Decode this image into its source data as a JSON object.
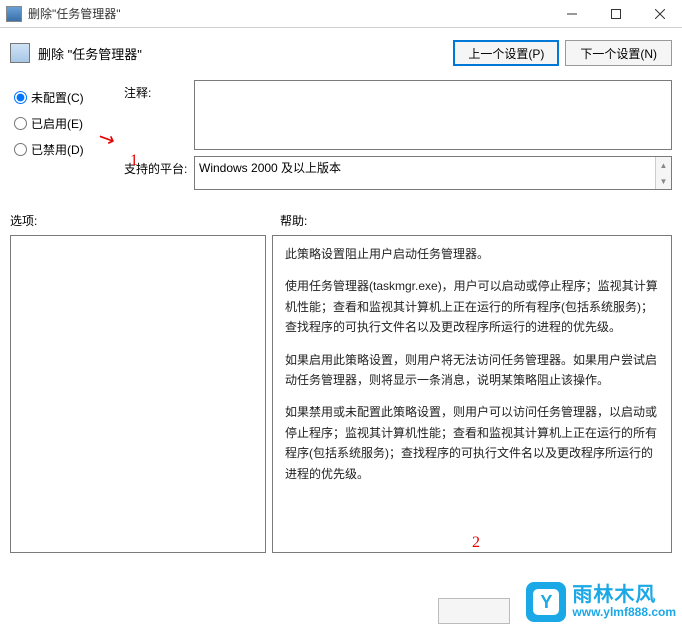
{
  "window": {
    "title": "删除\"任务管理器\""
  },
  "header": {
    "title": "删除 \"任务管理器\"",
    "prev_btn": "上一个设置(P)",
    "next_btn": "下一个设置(N)"
  },
  "radios": {
    "not_configured": "未配置(C)",
    "enabled": "已启用(E)",
    "disabled": "已禁用(D)",
    "selected": "not_configured"
  },
  "fields": {
    "comment_label": "注释:",
    "comment_value": "",
    "platform_label": "支持的平台:",
    "platform_value": "Windows 2000 及以上版本"
  },
  "labels": {
    "options": "选项:",
    "help": "帮助:"
  },
  "help": {
    "p1": "此策略设置阻止用户启动任务管理器。",
    "p2": "使用任务管理器(taskmgr.exe)，用户可以启动或停止程序；监视其计算机性能；查看和监视其计算机上正在运行的所有程序(包括系统服务)；查找程序的可执行文件名以及更改程序所运行的进程的优先级。",
    "p3": "如果启用此策略设置，则用户将无法访问任务管理器。如果用户尝试启动任务管理器，则将显示一条消息，说明某策略阻止该操作。",
    "p4": "如果禁用或未配置此策略设置，则用户可以访问任务管理器，以启动或停止程序；监视其计算机性能；查看和监视其计算机上正在运行的所有程序(包括系统服务)；查找程序的可执行文件名以及更改程序所运行的进程的优先级。"
  },
  "annotations": {
    "n1": "1",
    "n2": "2"
  },
  "watermark": {
    "logo_char": "Y",
    "brand": "雨林木风",
    "url": "www.ylmf888.com"
  }
}
